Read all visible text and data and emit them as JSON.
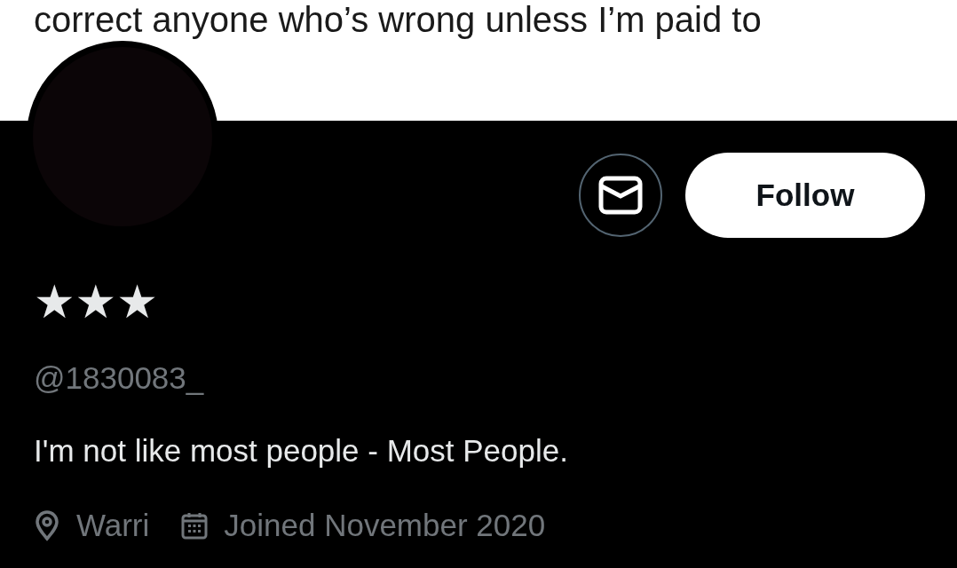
{
  "banner": {
    "text": "correct anyone who’s wrong unless I’m paid to"
  },
  "actions": {
    "follow": "Follow"
  },
  "profile": {
    "display_name": "★★★",
    "handle": "@1830083_",
    "bio": "I'm not like most people - Most People.",
    "location": "Warri",
    "joined": "Joined November 2020"
  }
}
